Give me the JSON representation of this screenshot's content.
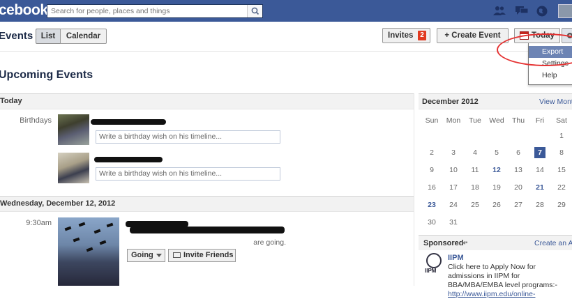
{
  "app": {
    "logo": "cebook"
  },
  "search": {
    "placeholder": "Search for people, places and things"
  },
  "header": {
    "title": "Events",
    "tabs": [
      "List",
      "Calendar"
    ],
    "invites_label": "Invites",
    "invites_count": "2",
    "create_label": "+ Create Event",
    "today_label": "Today"
  },
  "dropdown": {
    "items": [
      "Export",
      "Settings",
      "Help"
    ],
    "selected": "Export"
  },
  "main": {
    "heading": "Upcoming Events",
    "sections": [
      {
        "title": "Today",
        "row_label": "Birthdays",
        "wish_placeholder": "Write a birthday wish on his timeline..."
      },
      {
        "title": "Wednesday, December 12, 2012",
        "time": "9:30am",
        "partial_text": "are going.",
        "going_label": "Going",
        "invite_label": "Invite Friends"
      }
    ]
  },
  "calendar": {
    "month": "December 2012",
    "view_month": "View Month",
    "weekdays": [
      "Sun",
      "Mon",
      "Tue",
      "Wed",
      "Thu",
      "Fri",
      "Sat"
    ],
    "weeks": [
      [
        "",
        "",
        "",
        "",
        "",
        "",
        "1"
      ],
      [
        "2",
        "3",
        "4",
        "5",
        "6",
        "7",
        "8"
      ],
      [
        "9",
        "10",
        "11",
        "12",
        "13",
        "14",
        "15"
      ],
      [
        "16",
        "17",
        "18",
        "19",
        "20",
        "21",
        "22"
      ],
      [
        "23",
        "24",
        "25",
        "26",
        "27",
        "28",
        "29"
      ],
      [
        "30",
        "31",
        "",
        "",
        "",
        "",
        ""
      ]
    ],
    "today": "7",
    "event_days": [
      "12",
      "21",
      "23"
    ]
  },
  "sponsored": {
    "title": "Sponsored",
    "create_ad": "Create an Ad",
    "ad_title": "IIPM",
    "ad_logo_text": "IIPM",
    "ad_body": "Click here to Apply Now for admissions in IIPM for BBA/MBA/EMBA level programs:-",
    "ad_link": "http://www.iipm.edu/online-"
  },
  "colors": {
    "brand": "#3b5998",
    "badge": "#e13a20",
    "annotation": "#e53131",
    "dropdown_highlight": "#6d84b4"
  }
}
